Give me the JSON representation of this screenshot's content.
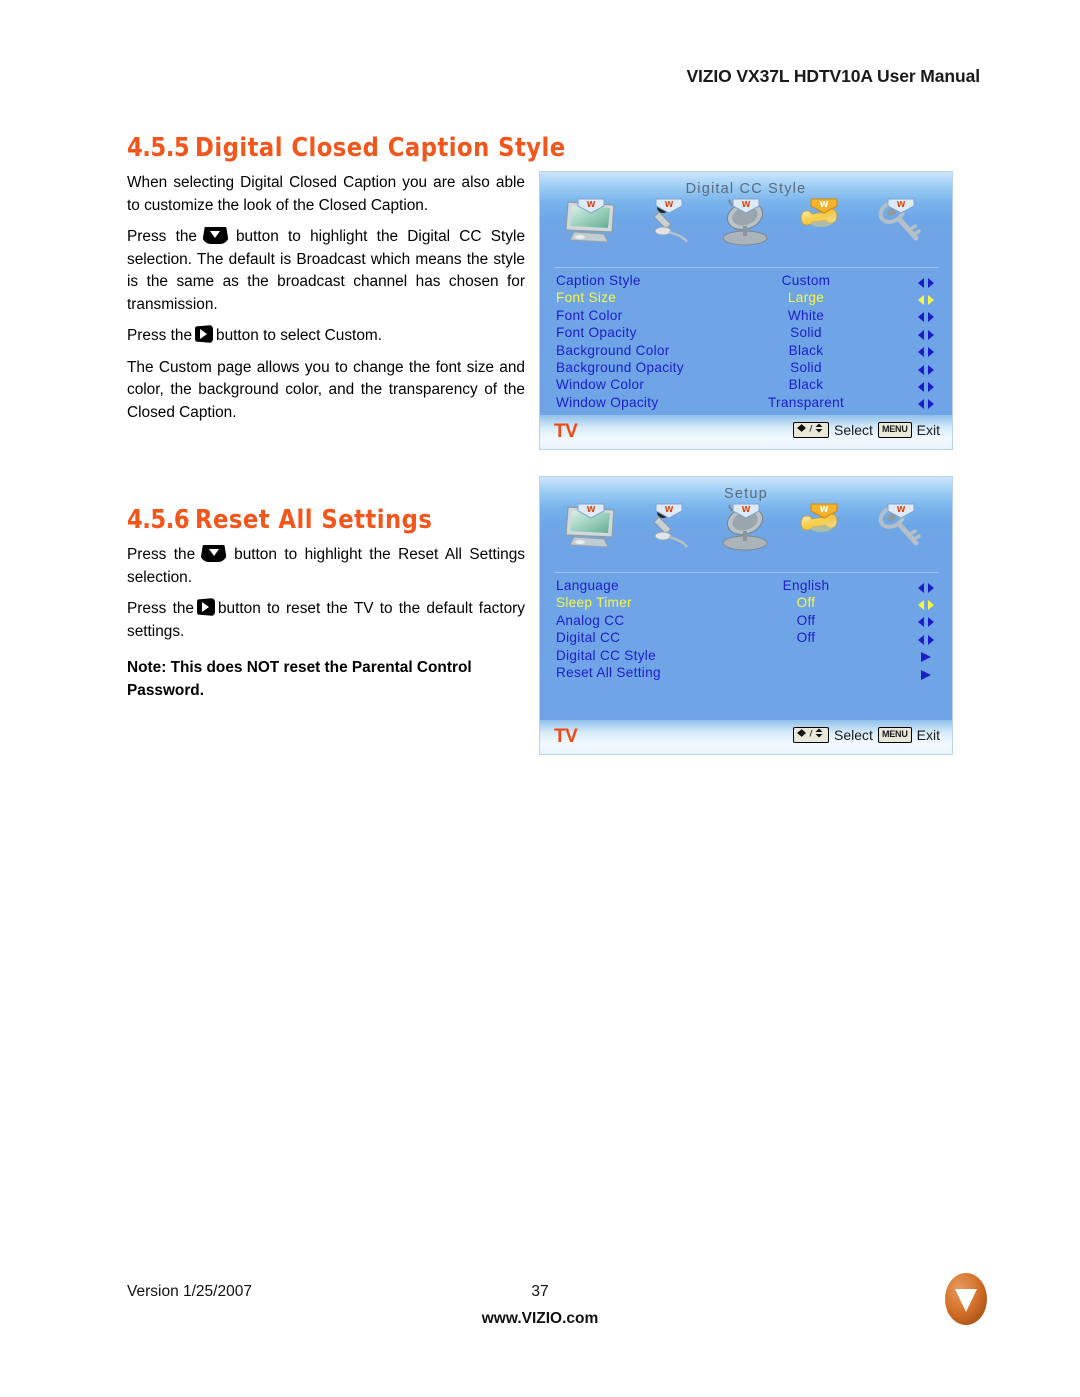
{
  "header": {
    "title": "VIZIO VX37L HDTV10A User Manual"
  },
  "sections": [
    {
      "number": "4.5.5",
      "title": "Digital Closed Caption Style",
      "paragraphs": [
        "When selecting Digital Closed Caption you are also able to customize the look of the Closed Caption.",
        "Style selection.  The default is Broadcast which means the style is the same as the broadcast channel has chosen for transmission.",
        "The Custom page allows you to change the font size and color, the background color, and the transparency of the Closed Caption."
      ],
      "press_down_prefix": "Press the",
      "press_down_suffix": "button to highlight the Digital CC",
      "press_right_prefix": "Press the",
      "press_right_suffix": "button to select Custom."
    },
    {
      "number": "4.5.6",
      "title": "Reset All Settings",
      "press_down_prefix": "Press the",
      "press_down_suffix": "button to highlight the Reset All Settings selection.",
      "press_right_prefix": "Press the",
      "press_right_suffix": "button to reset the TV to the default factory settings.",
      "note": "Note: This does NOT reset the Parental Control Password."
    }
  ],
  "osd_panels": [
    {
      "id": "digital-cc-style",
      "title": "Digital  CC  Style",
      "icons": [
        "monitor-icon",
        "microphone-icon",
        "satellite-dish-icon",
        "wrench-icon",
        "key-icon"
      ],
      "active_icon_index": 3,
      "rows": [
        {
          "label": "Caption  Style",
          "value": "Custom",
          "arrow": "left-right",
          "highlighted": false
        },
        {
          "label": "Font  Size",
          "value": "Large",
          "arrow": "left-right",
          "highlighted": true
        },
        {
          "label": "Font  Color",
          "value": "White",
          "arrow": "left-right",
          "highlighted": false
        },
        {
          "label": "Font  Opacity",
          "value": "Solid",
          "arrow": "left-right",
          "highlighted": false
        },
        {
          "label": "Background  Color",
          "value": "Black",
          "arrow": "left-right",
          "highlighted": false
        },
        {
          "label": "Background  Opacity",
          "value": "Solid",
          "arrow": "left-right",
          "highlighted": false
        },
        {
          "label": "Window  Color",
          "value": "Black",
          "arrow": "left-right",
          "highlighted": false
        },
        {
          "label": "Window  Opacity",
          "value": "Transparent",
          "arrow": "left-right",
          "highlighted": false
        }
      ],
      "source_label": "TV",
      "hint_select": "Select",
      "hint_menu_key": "MENU",
      "hint_exit": "Exit"
    },
    {
      "id": "setup",
      "title": "Setup",
      "icons": [
        "monitor-icon",
        "microphone-icon",
        "satellite-dish-icon",
        "wrench-icon",
        "key-icon"
      ],
      "active_icon_index": 3,
      "rows": [
        {
          "label": "Language",
          "value": "English",
          "arrow": "left-right",
          "highlighted": false
        },
        {
          "label": "Sleep  Timer",
          "value": "Off",
          "arrow": "left-right",
          "highlighted": true
        },
        {
          "label": "Analog CC",
          "value": "Off",
          "arrow": "left-right",
          "highlighted": false
        },
        {
          "label": "Digital  CC",
          "value": "Off",
          "arrow": "left-right",
          "highlighted": false
        },
        {
          "label": "Digital  CC  Style",
          "value": "",
          "arrow": "right",
          "highlighted": false
        },
        {
          "label": "Reset  All  Setting",
          "value": "",
          "arrow": "right",
          "highlighted": false
        }
      ],
      "source_label": "TV",
      "hint_select": "Select",
      "hint_menu_key": "MENU",
      "hint_exit": "Exit"
    }
  ],
  "footer": {
    "version": "Version 1/25/2007",
    "page_number": "37",
    "website": "www.VIZIO.com",
    "logo_letter": "V"
  },
  "colors": {
    "heading_orange": "#F4551B",
    "osd_label_blue": "#1D1DC8",
    "osd_highlight_yellow": "#F7F743",
    "osd_bg_blue": "#6FA5E6",
    "tv_orange": "#EF4A14",
    "logo_orange": "#D4722A"
  }
}
